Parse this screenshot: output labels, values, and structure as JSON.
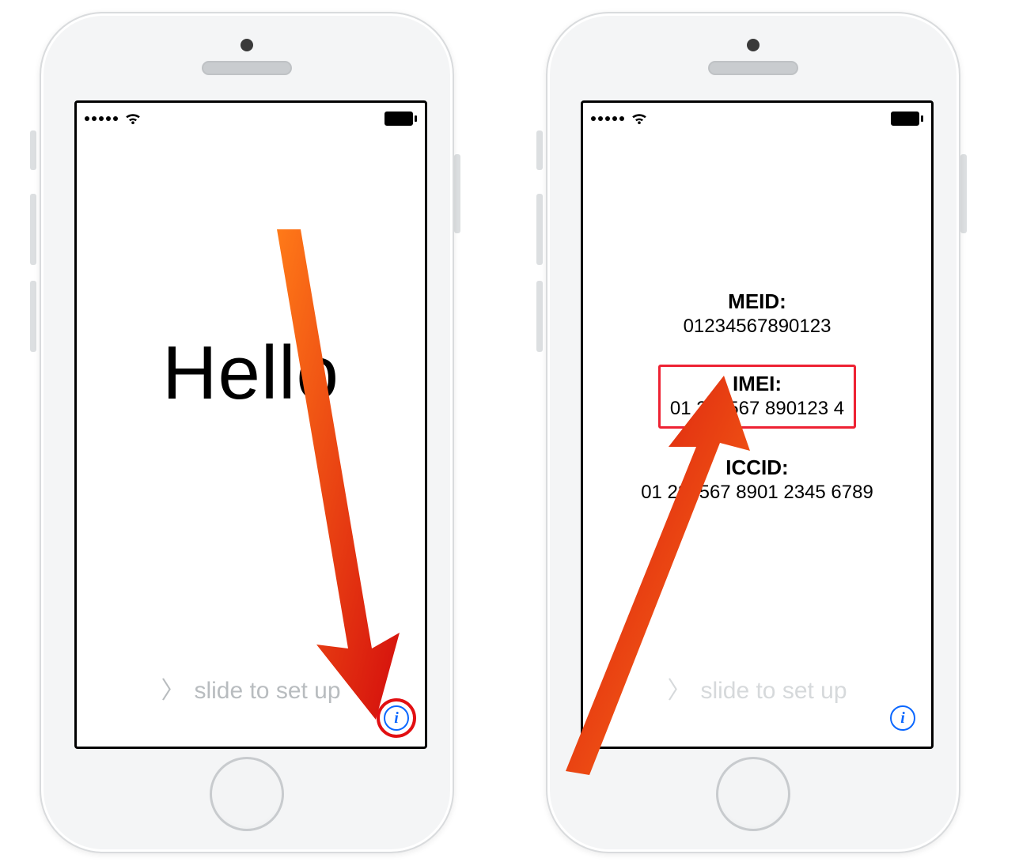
{
  "left": {
    "hello_text": "Hello",
    "slide_text": "slide to set up"
  },
  "right": {
    "info": {
      "meid_label": "MEID:",
      "meid_value": "01234567890123",
      "imei_label": "IMEI:",
      "imei_value": "01 234567 890123 4",
      "iccid_label": "ICCID:",
      "iccid_value": "01 234567 8901 2345 6789"
    },
    "slide_text": "slide to set up"
  },
  "colors": {
    "accent_red": "#e20f12",
    "info_blue": "#0a67ff"
  }
}
